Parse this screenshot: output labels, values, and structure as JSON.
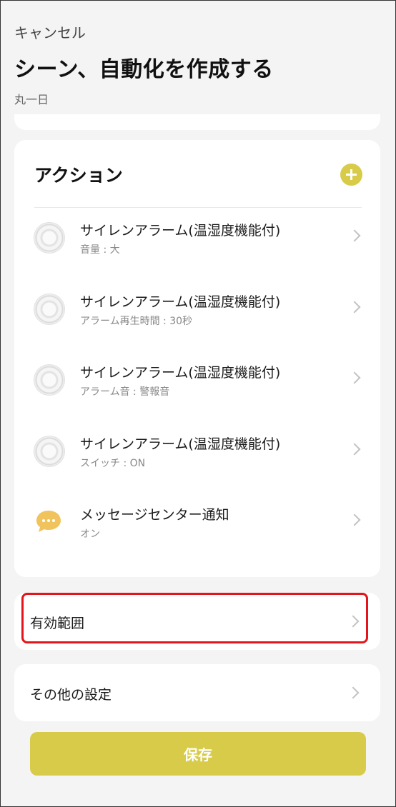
{
  "header": {
    "cancel_label": "キャンセル",
    "title": "シーン、自動化を作成する",
    "subtitle": "丸一日"
  },
  "actions": {
    "title": "アクション",
    "add_icon": "plus-circle-icon",
    "items": [
      {
        "icon": "siren-device-icon",
        "title": "サイレンアラーム(温湿度機能付)",
        "detail": "音量 : 大"
      },
      {
        "icon": "siren-device-icon",
        "title": "サイレンアラーム(温湿度機能付)",
        "detail": "アラーム再生時間 : 30秒"
      },
      {
        "icon": "siren-device-icon",
        "title": "サイレンアラーム(温湿度機能付)",
        "detail": "アラーム音 : 警報音"
      },
      {
        "icon": "siren-device-icon",
        "title": "サイレンアラーム(温湿度機能付)",
        "detail": "スイッチ : ON"
      },
      {
        "icon": "message-bubble-icon",
        "title": "メッセージセンター通知",
        "detail": "オン"
      }
    ]
  },
  "menu": {
    "scope_label": "有効範囲",
    "other_settings_label": "その他の設定"
  },
  "save_label": "保存",
  "colors": {
    "accent": "#d8cb4a",
    "highlight": "#e3141b",
    "background": "#f4f4f4",
    "message_icon": "#f1c35c"
  }
}
